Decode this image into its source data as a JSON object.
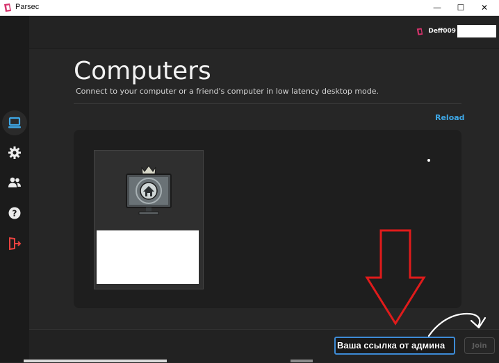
{
  "window": {
    "title": "Parsec",
    "controls": [
      "—",
      "☐",
      "✕"
    ]
  },
  "sidebar": {
    "items": [
      {
        "name": "computers",
        "icon": "monitor-icon",
        "active": true
      },
      {
        "name": "settings",
        "icon": "gear-icon",
        "active": false
      },
      {
        "name": "friends",
        "icon": "users-icon",
        "active": false
      },
      {
        "name": "help",
        "icon": "question-icon",
        "active": false
      },
      {
        "name": "logout",
        "icon": "logout-icon",
        "active": false
      }
    ]
  },
  "header": {
    "user_name": "Deff009"
  },
  "main": {
    "title": "Computers",
    "subtitle": "Connect to your computer or a friend's computer in low latency desktop mode.",
    "reload_label": "Reload"
  },
  "computers": [
    {
      "icon": "crowned-monitor-home-icon",
      "label": ""
    }
  ],
  "bottom": {
    "link_value": "Ваша ссылка от админа",
    "join_label": "Join"
  },
  "colors": {
    "accent": "#3ea7e6",
    "brand": "#d6336c",
    "annotation": "#e01b1b"
  }
}
